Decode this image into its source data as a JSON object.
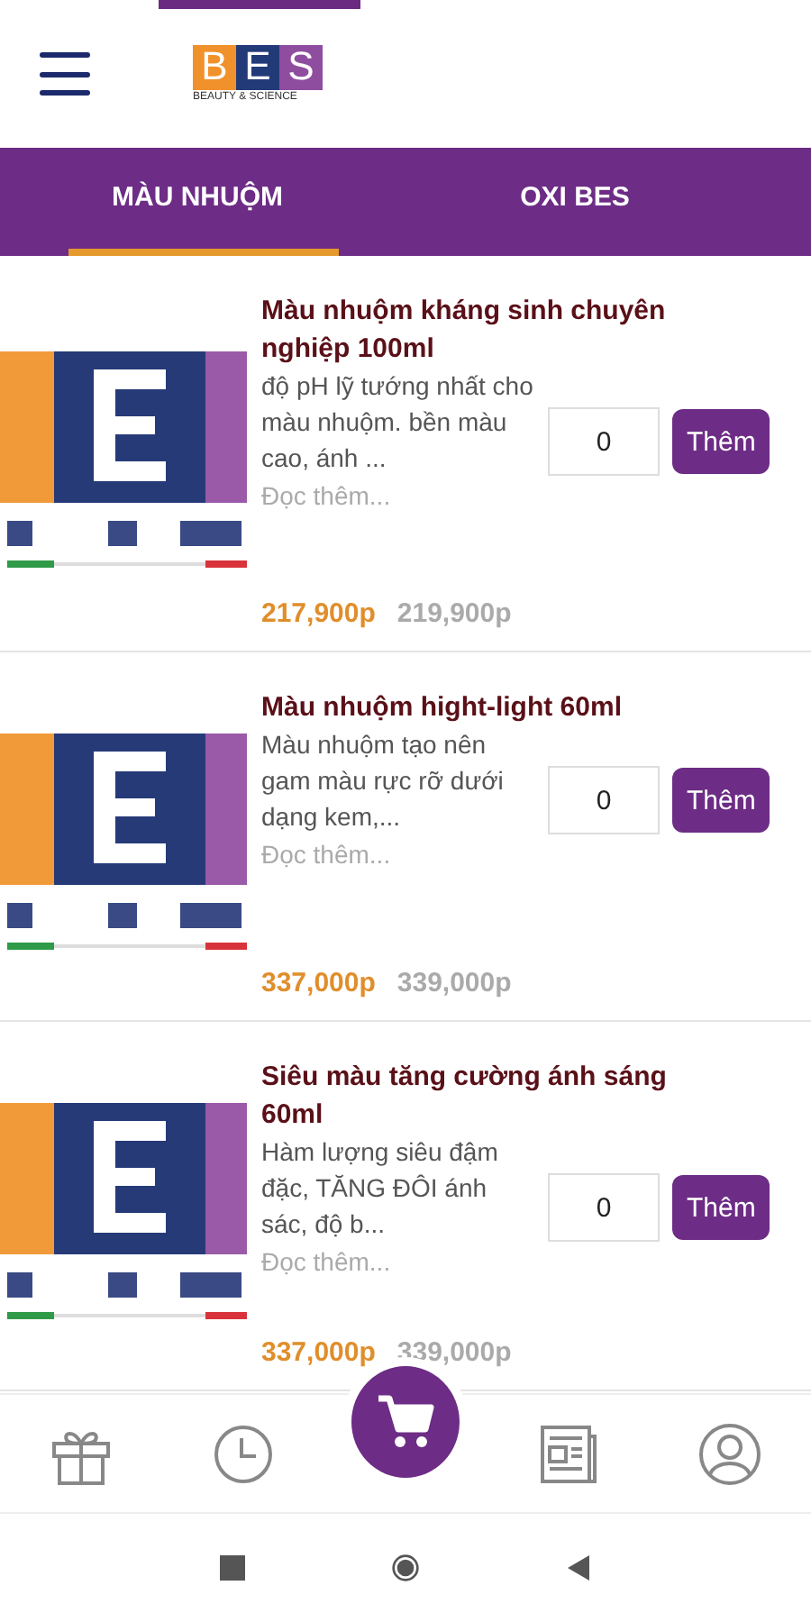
{
  "header": {
    "logo": {
      "letters": [
        "B",
        "E",
        "S"
      ],
      "tagline": "BEAUTY & SCIENCE"
    }
  },
  "tabs": [
    {
      "label": "MÀU NHUỘM",
      "selected": true
    },
    {
      "label": "OXI BES",
      "selected": false
    }
  ],
  "products": [
    {
      "title": "Màu nhuộm kháng sinh chuyên nghiệp 100ml",
      "description": "độ pH lỹ tướng nhất cho màu nhuộm. bền màu cao, ánh ...",
      "read_more": "Đọc thêm...",
      "price": "217,900p",
      "old_price": "219,900p",
      "quantity": "0",
      "button": "Thêm"
    },
    {
      "title": "Màu nhuộm hight-light 60ml",
      "description": "Màu nhuộm tạo nên gam màu rực rỡ dưới dạng kem,...",
      "read_more": "Đọc thêm...",
      "price": "337,000p",
      "old_price": "339,000p",
      "quantity": "0",
      "button": "Thêm"
    },
    {
      "title": "Siêu màu tăng cường ánh sáng 60ml",
      "description": "Hàm lượng siêu đậm đặc, TĂNG ĐÔI ánh sác, độ b...",
      "read_more": "Đọc thêm...",
      "price": "337,000p",
      "old_price": "339,000p",
      "quantity": "0",
      "button": "Thêm"
    }
  ],
  "bottom_nav": [
    {
      "kind": "gift"
    },
    {
      "kind": "clock"
    },
    {
      "kind": "cart"
    },
    {
      "kind": "news"
    },
    {
      "kind": "user"
    }
  ],
  "system_nav": [
    {
      "kind": "square"
    },
    {
      "kind": "circle"
    },
    {
      "kind": "back"
    }
  ]
}
